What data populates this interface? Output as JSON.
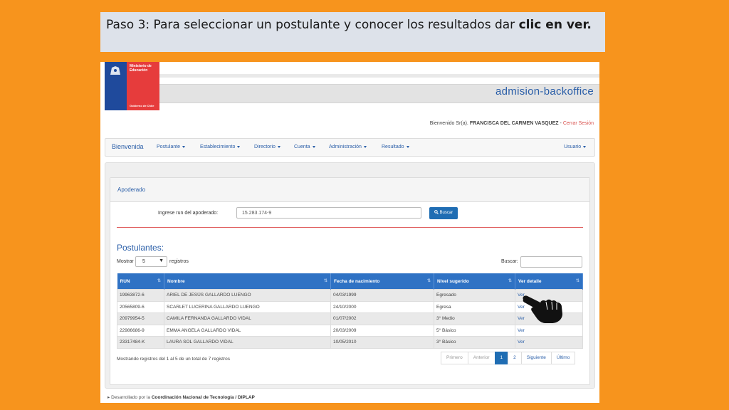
{
  "caption": {
    "text": "Paso 3: Para seleccionar un postulante y conocer los resultados dar ",
    "bold": "clic en ver."
  },
  "logo": {
    "ministry": "Ministerio de Educación",
    "gov": "Gobierno de Chile"
  },
  "header": {
    "app_title": "admision-backoffice",
    "welcome_prefix": "Bienvenido Sr(a).",
    "user_name": "FRANCISCA DEL CARMEN VASQUEZ",
    "separator": "-",
    "logout": "Cerrar Sesión"
  },
  "nav": {
    "brand": "Bienvenida",
    "items": [
      "Postulante",
      "Establecimiento",
      "Directorio",
      "Cuenta",
      "Administración",
      "Resultado"
    ],
    "user": "Usuario"
  },
  "panel": {
    "title": "Apoderado",
    "run_label": "Ingrese run del apoderado:",
    "run_value": "15.283.174-9",
    "search_button": "Buscar"
  },
  "postulantes": {
    "title": "Postulantes:",
    "show_label": "Mostrar",
    "page_size": "5",
    "records_label": "registros",
    "search_label": "Buscar:",
    "columns": [
      "RUN",
      "Nombre",
      "Fecha de nacimiento",
      "Nivel sugerido",
      "Ver detalle"
    ],
    "rows": [
      {
        "run": "19963872-6",
        "nombre": "ARIEL DE JESÚS GALLARDO LUENGO",
        "fecha": "04/03/1999",
        "nivel": "Egresado",
        "ver": "Ver"
      },
      {
        "run": "20565809-6",
        "nombre": "SCARLET LUCERINA GALLARDO LUENGO",
        "fecha": "24/10/2000",
        "nivel": "Egresa",
        "ver": "Ver"
      },
      {
        "run": "20979954-5",
        "nombre": "CAMILA FERNANDA GALLARDO VIDAL",
        "fecha": "01/07/2002",
        "nivel": "3° Medio",
        "ver": "Ver"
      },
      {
        "run": "22986686-9",
        "nombre": "EMMA ANGELA GALLARDO VIDAL",
        "fecha": "20/03/2009",
        "nivel": "5° Básico",
        "ver": "Ver"
      },
      {
        "run": "23317484-K",
        "nombre": "LAURA SOL GALLARDO VIDAL",
        "fecha": "10/05/2010",
        "nivel": "3° Básico",
        "ver": "Ver"
      }
    ],
    "info": "Mostrando registros del 1 al 5 de un total de 7 registros",
    "pagination": [
      "Primero",
      "Anterior",
      "1",
      "2",
      "Siguiente",
      "Último"
    ]
  },
  "footer": {
    "prefix": "Desarrollado por la",
    "org": "Coordinación Nacional de Tecnología / DIPLAP"
  }
}
